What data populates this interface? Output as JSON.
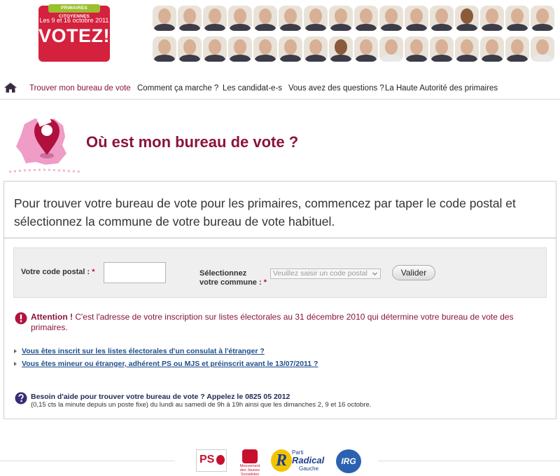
{
  "header": {
    "logo_top": "PRIMAIRES CITOYENNES",
    "logo_date": "Les 9 et 16 octobre 2011",
    "logo_main": "VOTEZ!"
  },
  "nav": {
    "items": [
      {
        "label": "Trouver mon bureau de vote",
        "active": true
      },
      {
        "label": "Comment ça marche ?"
      },
      {
        "label": "Les candidat-e-s"
      },
      {
        "label": "Vous avez des questions ?"
      },
      {
        "label": "La Haute Autorité des primaires"
      }
    ]
  },
  "page": {
    "title": "Où est mon bureau de vote ?"
  },
  "intro": "Pour trouver votre bureau de vote pour les primaires, commencez par taper le code postal et sélectionnez la commune de votre bureau de vote habituel.",
  "form": {
    "postal_label": "Votre code postal :",
    "postal_value": "",
    "commune_label_1": "Sélectionnez",
    "commune_label_2": "votre commune :",
    "required_mark": "*",
    "commune_selected": "Veuillez saisir un code postal",
    "submit_label": "Valider"
  },
  "alert": {
    "title": "Attention !",
    "text": " C'est l'adresse de votre inscription sur listes électorales au 31 décembre 2010 qui détermine votre bureau de vote des primaires."
  },
  "links": [
    "Vous êtes inscrit sur les listes électorales d'un consulat à l'étranger ?",
    "Vous êtes mineur ou étranger, adhérent PS ou MJS et préinscrit avant le 13/07/2011 ?"
  ],
  "help": {
    "title": "Besoin d'aide pour trouver votre bureau de vote ? Appelez le 0825 05 2012",
    "sub": "(0,15 cts la minute depuis un poste fixe) du lundi au samedi de 9h à 19h ainsi que les dimanches 2, 9 et 16 octobre."
  },
  "footer": {
    "ps": "PS",
    "mjs": "Mouvement des Jeunes Socialistes",
    "prg_r": "R",
    "prg_1": "Parti",
    "prg_2": "Radical",
    "prg_3": "Gauche",
    "irg": "IRG"
  },
  "colors": {
    "brand_red": "#d4213d",
    "title_maroon": "#8a1538",
    "link_blue": "#1f4e8c"
  }
}
